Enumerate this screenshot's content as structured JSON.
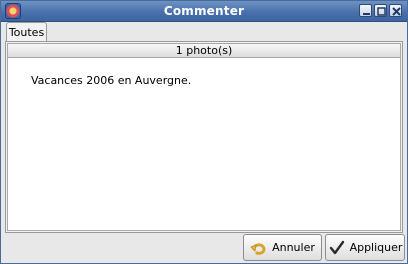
{
  "window": {
    "title": "Commenter"
  },
  "tabs": [
    {
      "label": "Toutes"
    }
  ],
  "list": {
    "header": "1 photo(s)"
  },
  "comment": {
    "value": "Vacances 2006 en Auvergne."
  },
  "buttons": {
    "cancel_label": "Annuler",
    "apply_label": "Appliquer"
  },
  "icons": {
    "app": "app-icon",
    "minimize": "minimize-icon",
    "maximize": "maximize-icon",
    "close": "close-icon",
    "cancel": "undo-arrow-icon",
    "apply": "checkmark-icon"
  },
  "colors": {
    "titlebar": "#4a71ad",
    "accent": "#f0c24a"
  }
}
